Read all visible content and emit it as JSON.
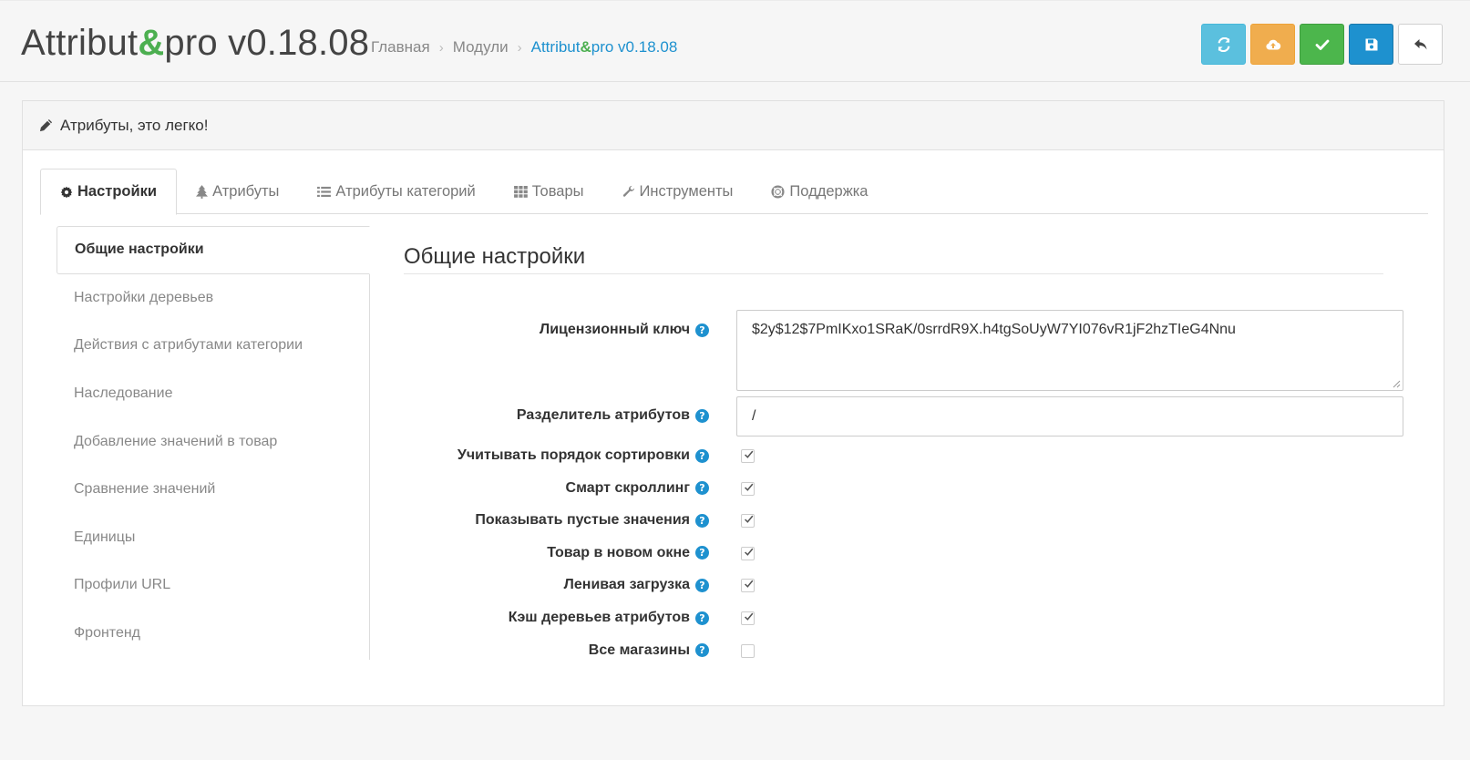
{
  "header": {
    "title_prefix": "Attribut",
    "title_amp": "&",
    "title_suffix": "pro v0.18.08",
    "breadcrumb": {
      "home": "Главная",
      "modules": "Модули",
      "current_prefix": "Attribut",
      "current_amp": "&",
      "current_suffix": "pro v0.18.08"
    }
  },
  "toolbar": {
    "buttons": [
      {
        "icon": "refresh-icon",
        "color": "#5bc0de"
      },
      {
        "icon": "cloud-upload-icon",
        "color": "#f0ad4e"
      },
      {
        "icon": "check-icon",
        "color": "#4cb64c"
      },
      {
        "icon": "save-icon",
        "color": "#1e91cf"
      },
      {
        "icon": "reply-icon",
        "color": "#ffffff"
      }
    ]
  },
  "panel": {
    "heading": "Атрибуты, это легко!",
    "tabs": [
      {
        "label": "Настройки",
        "icon": "gear-icon",
        "active": true
      },
      {
        "label": "Атрибуты",
        "icon": "tree-icon"
      },
      {
        "label": "Атрибуты категорий",
        "icon": "list-icon"
      },
      {
        "label": "Товары",
        "icon": "grid-icon"
      },
      {
        "label": "Инструменты",
        "icon": "wrench-icon"
      },
      {
        "label": "Поддержка",
        "icon": "lifebuoy-icon"
      }
    ],
    "sidenav": [
      "Общие настройки",
      "Настройки деревьев",
      "Действия с атрибутами категории",
      "Наследование",
      "Добавление значений в товар",
      "Сравнение значений",
      "Единицы",
      "Профили URL",
      "Фронтенд"
    ]
  },
  "settings": {
    "title": "Общие настройки",
    "license_label": "Лицензионный ключ",
    "license_value": "$2y$12$7PmIKxo1SRaK/0srrdR9X.h4tgSoUyW7YI076vR1jF2hzTIeG4Nnu",
    "separator_label": "Разделитель атрибутов",
    "separator_value": "/",
    "help_glyph": "?",
    "checkboxes": [
      {
        "label": "Учитывать порядок сортировки",
        "checked": true
      },
      {
        "label": "Смарт скроллинг",
        "checked": true
      },
      {
        "label": "Показывать пустые значения",
        "checked": true
      },
      {
        "label": "Товар в новом окне",
        "checked": true
      },
      {
        "label": "Ленивая загрузка",
        "checked": true
      },
      {
        "label": "Кэш деревьев атрибутов",
        "checked": true
      },
      {
        "label": "Все магазины",
        "checked": false
      }
    ]
  }
}
